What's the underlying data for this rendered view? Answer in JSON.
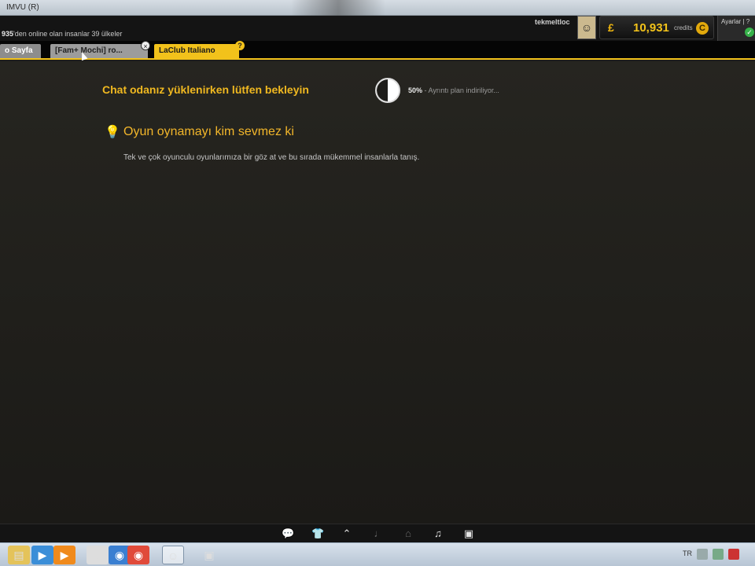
{
  "window": {
    "title": "IMVU (R)"
  },
  "header": {
    "online_count": "935",
    "online_text": "'den online olan insanlar 39 ülkeler",
    "username": "tekmeltloc",
    "credits_amount": "10,931",
    "credits_unit": "credits",
    "settings_label": "Ayarlar | ?"
  },
  "tabs": [
    {
      "label": "o Sayfa"
    },
    {
      "label": "[Fam+ Mochi] ro..."
    },
    {
      "label": "LaClub Italiano"
    }
  ],
  "tab_close_symbol": "×",
  "tab_help_symbol": "?",
  "main": {
    "loading_title": "Chat odanız yüklenirken lütfen bekleyin",
    "progress_percent": "50%",
    "progress_status": " - Ayrıntı plan indiriliyor...",
    "progress_value": 0.5,
    "tip_title": "Oyun oynamayı kim sevmez ki",
    "tip_body": "Tek ve çok oyunculu oyunlarımıza bir göz at ve bu sırada mükemmel insanlarla tanış."
  },
  "toolbar_icons": [
    "chat-icon",
    "outfit-icon",
    "hanger-icon",
    "music-note-icon",
    "home-icon",
    "camera-music-icon",
    "photo-icon"
  ],
  "taskbar": {
    "language": "TR"
  },
  "colors": {
    "accent": "#f2c21b",
    "title": "#f0b820",
    "background": "#1e1d1a"
  }
}
